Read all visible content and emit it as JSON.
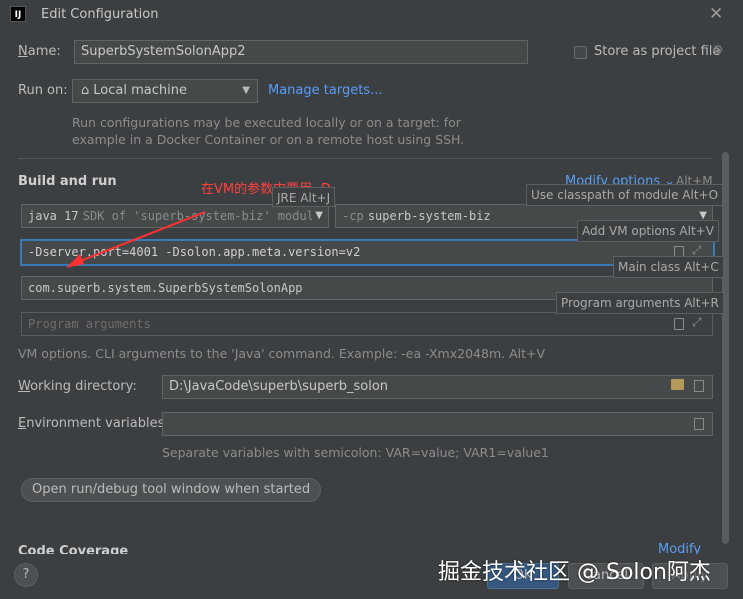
{
  "dialog": {
    "app_icon": "IJ",
    "title": "Edit Configuration",
    "close_icon": "✕"
  },
  "name_row": {
    "label": "Name:",
    "value": "SuperbSystemSolonApp2",
    "store_label": "Store as project file"
  },
  "run_on": {
    "label": "Run on:",
    "selected": "Local machine",
    "manage_link": "Manage targets...",
    "hint_line1": "Run configurations may be executed locally or on a target: for",
    "hint_line2": "example in a Docker Container or on a remote host using SSH."
  },
  "build_and_run": {
    "header": "Build and run",
    "modify_options": "Modify options",
    "modify_shortcut": "Alt+M",
    "jre_prefix": "java 17",
    "jre_rest": "SDK of 'superb-system-biz' modul",
    "classpath_prefix": "-cp",
    "classpath_module": "superb-system-biz",
    "vm_options": "-Dserver.port=4001 -Dsolon.app.meta.version=v2",
    "main_class": "com.superb.system.SuperbSystemSolonApp",
    "program_args_placeholder": "Program arguments",
    "vm_hint": "VM options. CLI arguments to the 'Java' command. Example: -ea -Xmx2048m. Alt+V"
  },
  "tooltips": {
    "jre": "JRE Alt+J",
    "classpath": "Use classpath of module Alt+O",
    "vm": "Add VM options Alt+V",
    "main_class": "Main class Alt+C",
    "program_args": "Program arguments Alt+R"
  },
  "annotation": "在VM的参数中要用 -D",
  "working_dir": {
    "label": "Working directory:",
    "value": "D:\\JavaCode\\superb\\superb_solon"
  },
  "env_vars": {
    "label": "Environment variables:",
    "value": "",
    "hint": "Separate variables with semicolon: VAR=value; VAR1=value1"
  },
  "chip": "Open run/debug tool window when started",
  "code_coverage": {
    "header": "Code Coverage",
    "modify": "Modify"
  },
  "footer": {
    "help": "?",
    "ok": "OK",
    "cancel": "Cancel",
    "apply": "Apply"
  },
  "watermark": "掘金技术社区 @ Solon阿杰",
  "colors": {
    "background": "#3c3f41",
    "field": "#45494a",
    "link": "#589df6",
    "focus": "#3d79b7",
    "annotation": "#ff4040"
  }
}
